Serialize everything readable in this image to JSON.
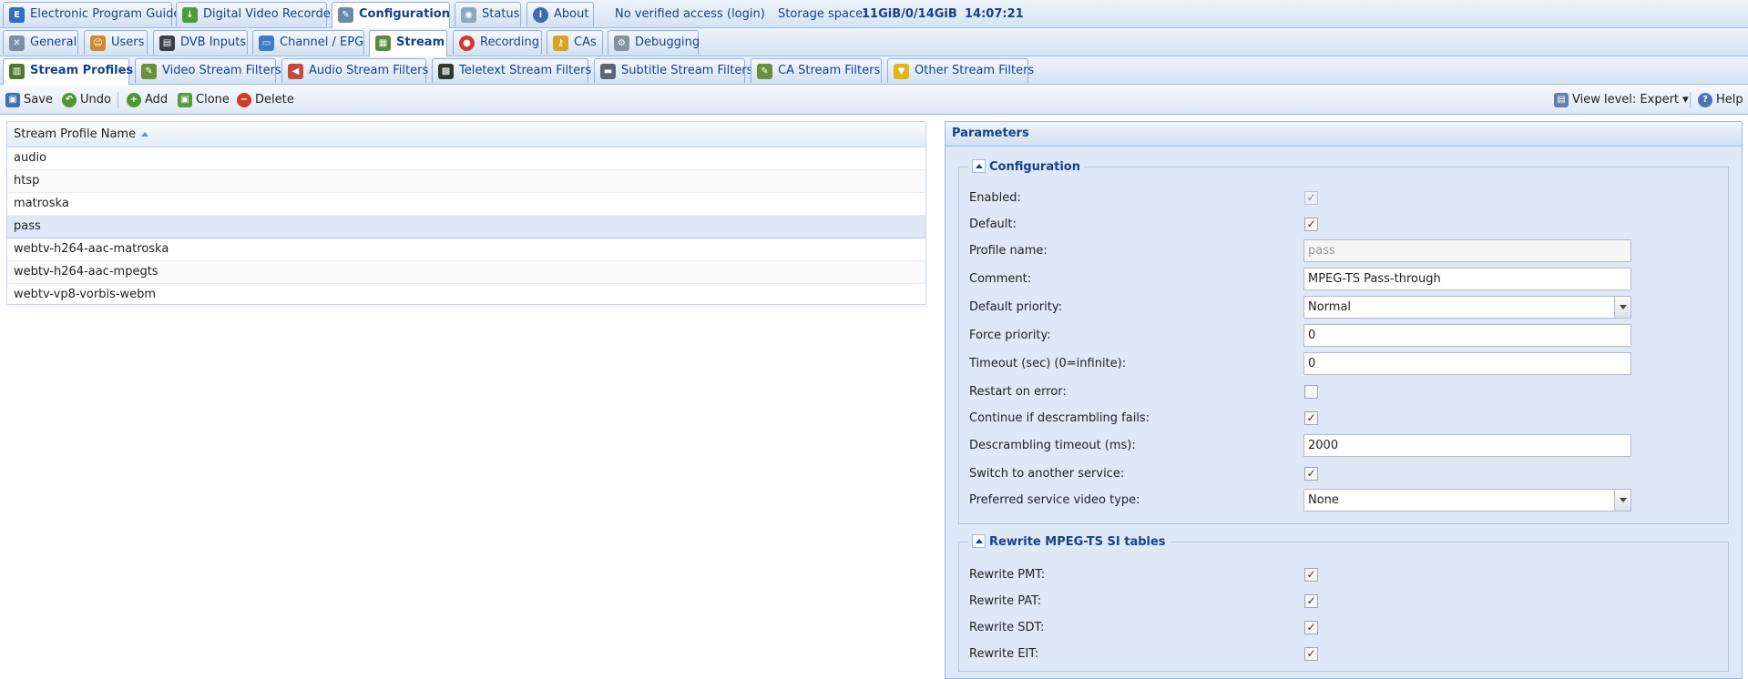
{
  "top_tabs": {
    "epg": {
      "label": "Electronic Program Guide",
      "icon": "epg-icon"
    },
    "dvr": {
      "label": "Digital Video Recorder",
      "icon": "download-icon"
    },
    "config": {
      "label": "Configuration",
      "icon": "wrench-icon"
    },
    "status": {
      "label": "Status",
      "icon": "eye-icon"
    },
    "about": {
      "label": "About",
      "icon": "info-icon"
    }
  },
  "status_bar": {
    "access": "No verified access",
    "login": "(login)",
    "storage_label": "Storage space:",
    "storage_value": "11GiB/0/14GiB",
    "time": "14:07:21"
  },
  "config_tabs": [
    {
      "label": "General",
      "icon": "tools-icon"
    },
    {
      "label": "Users",
      "icon": "users-icon"
    },
    {
      "label": "DVB Inputs",
      "icon": "film-icon"
    },
    {
      "label": "Channel / EPG",
      "icon": "tv-icon"
    },
    {
      "label": "Stream",
      "icon": "stream-icon"
    },
    {
      "label": "Recording",
      "icon": "record-icon"
    },
    {
      "label": "CAs",
      "icon": "key-icon"
    },
    {
      "label": "Debugging",
      "icon": "gears-icon"
    }
  ],
  "stream_tabs": [
    {
      "label": "Stream Profiles",
      "icon": "film-strip-icon"
    },
    {
      "label": "Video Stream Filters",
      "icon": "video-edit-icon"
    },
    {
      "label": "Audio Stream Filters",
      "icon": "speaker-icon"
    },
    {
      "label": "Teletext Stream Filters",
      "icon": "teletext-icon"
    },
    {
      "label": "Subtitle Stream Filters",
      "icon": "subtitle-icon"
    },
    {
      "label": "CA Stream Filters",
      "icon": "ca-filter-icon"
    },
    {
      "label": "Other Stream Filters",
      "icon": "funnel-icon"
    }
  ],
  "toolbar": {
    "save": "Save",
    "undo": "Undo",
    "add": "Add",
    "clone": "Clone",
    "delete": "Delete",
    "view_level": "View level: Expert",
    "help": "Help"
  },
  "grid": {
    "column_header": "Stream Profile Name",
    "rows": [
      "audio",
      "htsp",
      "matroska",
      "pass",
      "webtv-h264-aac-matroska",
      "webtv-h264-aac-mpegts",
      "webtv-vp8-vorbis-webm"
    ],
    "selected": "pass"
  },
  "parameters": {
    "title": "Parameters",
    "configuration": {
      "legend": "Configuration",
      "enabled_label": "Enabled:",
      "enabled": true,
      "default_label": "Default:",
      "default": true,
      "profile_name_label": "Profile name:",
      "profile_name": "pass",
      "comment_label": "Comment:",
      "comment": "MPEG-TS Pass-through",
      "default_priority_label": "Default priority:",
      "default_priority": "Normal",
      "force_priority_label": "Force priority:",
      "force_priority": "0",
      "timeout_label": "Timeout (sec) (0=infinite):",
      "timeout": "0",
      "restart_label": "Restart on error:",
      "restart": false,
      "continue_label": "Continue if descrambling fails:",
      "continue": true,
      "descr_timeout_label": "Descrambling timeout (ms):",
      "descr_timeout": "2000",
      "switch_label": "Switch to another service:",
      "switch": true,
      "pref_video_label": "Preferred service video type:",
      "pref_video": "None"
    },
    "rewrite": {
      "legend": "Rewrite MPEG-TS SI tables",
      "pmt_label": "Rewrite PMT:",
      "pat_label": "Rewrite PAT:",
      "sdt_label": "Rewrite SDT:",
      "eit_label": "Rewrite EIT:",
      "pmt": true,
      "pat": true,
      "sdt": true,
      "eit": true
    }
  }
}
